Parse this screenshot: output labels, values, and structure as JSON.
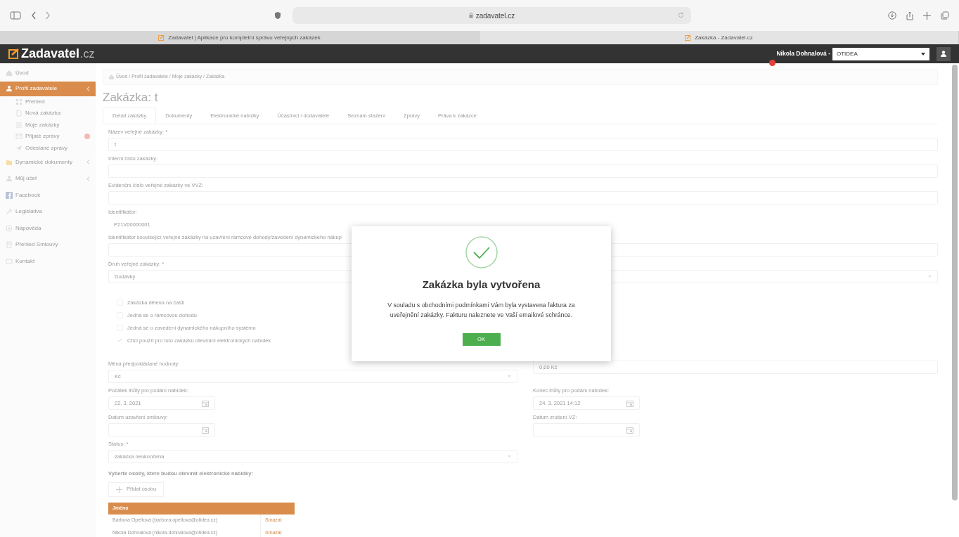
{
  "browser": {
    "address": "zadavatel.cz",
    "tabs": [
      {
        "label": "Zadavatel | Aplikace pro kompletní správu veřejných zakázek",
        "selected": false
      },
      {
        "label": "Zakázka - Zadavatel.cz",
        "selected": true
      }
    ]
  },
  "header": {
    "logo_main": "Zadavatel",
    "logo_suffix": ".cz",
    "user": "Nikola Dohnalová -",
    "organization": "OTIDEA",
    "notification": true
  },
  "sidebar": {
    "items": [
      {
        "label": "Úvod",
        "selected": false
      },
      {
        "label": "Profil zadavatele",
        "selected": true,
        "expandable": true,
        "children": [
          {
            "label": "Přehled",
            "selected": false
          },
          {
            "label": "Nová zakázka",
            "selected": false
          },
          {
            "label": "Moje zakázky",
            "selected": false
          },
          {
            "label": "Přijaté zprávy",
            "selected": false,
            "alert": true
          },
          {
            "label": "Odeslané zprávy",
            "selected": false
          }
        ]
      },
      {
        "label": "Dynamické dokumenty",
        "selected": false,
        "expandable": true
      },
      {
        "label": "Můj účet",
        "selected": false,
        "expandable": true
      },
      {
        "label": "Facebook",
        "selected": false
      },
      {
        "label": "Legislativa",
        "selected": false
      },
      {
        "label": "Nápověda",
        "selected": false
      },
      {
        "label": "Přehled Smlouvy",
        "selected": false
      },
      {
        "label": "Kontakt",
        "selected": false
      }
    ]
  },
  "breadcrumb": "Úvod / Profil zadavatele / Moje zakázky / Zakázka",
  "title": "Zakázka: t",
  "tabs": [
    {
      "label": "Detail zakázky",
      "selected": true
    },
    {
      "label": "Dokumenty",
      "selected": false
    },
    {
      "label": "Elektronické nabídky",
      "selected": false
    },
    {
      "label": "Účastníci / dodavatelé",
      "selected": false
    },
    {
      "label": "Seznam stažení",
      "selected": false
    },
    {
      "label": "Zprávy",
      "selected": false
    },
    {
      "label": "Práva k zakázce",
      "selected": false
    }
  ],
  "fields": [
    {
      "kind": "input",
      "label": "Název veřejné zakázky: *",
      "value": "t"
    },
    {
      "kind": "input",
      "label": "Interní číslo zakázky:"
    },
    {
      "kind": "input",
      "label": "Evidenční číslo veřejné zakázky ve VVZ:"
    },
    {
      "kind": "static",
      "label": "Identifikátor:",
      "value": "P21V00000001"
    },
    {
      "kind": "input",
      "label": "Identifikátor související veřejné zakázky na uzavření rámcové dohody/zavedení dynamického nákup"
    },
    {
      "kind": "select",
      "label": "Druh veřejné zakázky: *",
      "value": "Dodávky"
    }
  ],
  "checkboxes": [
    {
      "label": "Zakázka dělena na části",
      "checked": false
    },
    {
      "label": "Jedná se o rámcovou dohodu",
      "checked": false
    },
    {
      "label": "Jedná se o zavedení dynamického nákupního systému",
      "checked": false
    },
    {
      "label": "Chci použít pro tuto zakázku otevírání elektronických nabídek",
      "checked": true
    }
  ],
  "pairs": [
    {
      "left": {
        "kind": "select",
        "label": "Měna předpokládané hodnoty:",
        "value": "Kč"
      },
      "right": {
        "kind": "input",
        "value": "0,00 Kč"
      }
    },
    {
      "left": {
        "kind": "date",
        "label": "Počátek lhůty pro podání nabídek:",
        "value": "22. 3. 2021"
      },
      "right": {
        "kind": "date",
        "label": "Konec lhůty pro podání nabídek:",
        "value": "24. 3. 2021 14:12"
      }
    },
    {
      "left": {
        "kind": "date",
        "label": "Datum uzavření smlouvy:"
      },
      "right": {
        "kind": "date",
        "label": "Datum zrušení VZ:"
      }
    }
  ],
  "status": {
    "kind": "select",
    "label": "Status: *",
    "value": "zakázka neukončena"
  },
  "persons": {
    "heading": "Vyberte osoby, které budou otevírat elektronické nabídky:",
    "add_button": "Přidat osobu",
    "columns": [
      "Jméno"
    ],
    "rows": [
      {
        "name": "Barbora Opeltová (barbora.opeltova@otidea.cz)",
        "action": "Smazat"
      },
      {
        "name": "Nikola Dohnalová (nikola.dohnalova@otidea.cz)",
        "action": "Smazat"
      }
    ]
  },
  "modal": {
    "title": "Zakázka byla vytvořena",
    "message": "V souladu s obchodními podmínkami Vám byla vystavena faktura za uveřejnění zakázky. Fakturu naleznete ve Vaší emailové schránce.",
    "button": "OK"
  }
}
